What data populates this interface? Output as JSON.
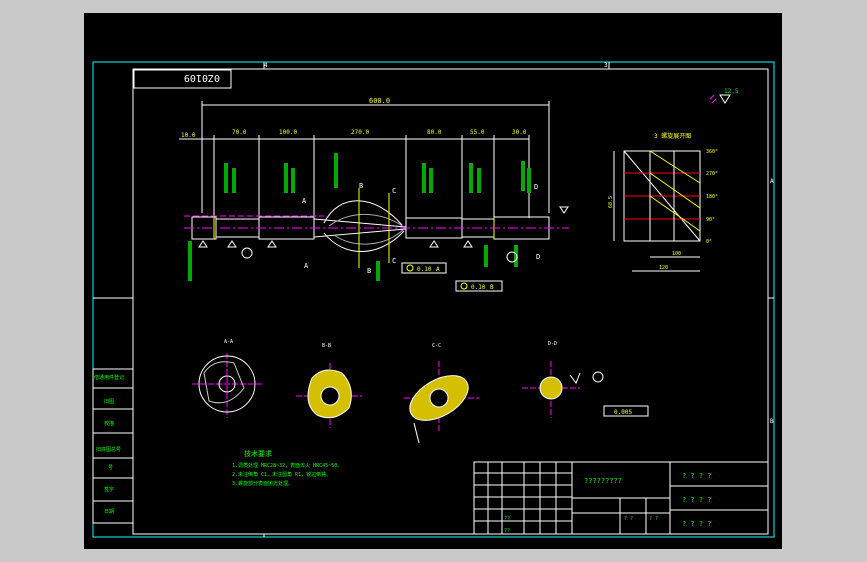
{
  "drawing": {
    "code_box": "0Z0109",
    "zone_top_a": "4",
    "zone_top_b": "3",
    "zone_right_a": "A",
    "zone_right_b": "B",
    "overall_dim": "600.0",
    "dims_top": [
      "10.0",
      "70.0",
      "100.0",
      "270.0",
      "80.0",
      "55.0",
      "30.0"
    ],
    "surface_symbol": "12.5",
    "section_labels": {
      "a": "A-A",
      "b": "B-B",
      "c": "C-C",
      "d": "D-D"
    },
    "cut_letters": {
      "a": "A",
      "b": "B",
      "c": "C",
      "d": "D"
    },
    "tolerance_1": "0.10",
    "tolerance_2": "0.10",
    "tolerance_3": "0.005",
    "datum_a": "A",
    "datum_b": "B",
    "unwrap_title": "3 螺旋展开图",
    "unwrap_angles": [
      "360°",
      "270°",
      "180°",
      "90°",
      "0°"
    ],
    "unwrap_width": "120",
    "unwrap_inner": "100",
    "unwrap_height": "68.5",
    "tech_heading": "技术要求",
    "tech_lines": [
      "1.调质处理 HRC28~32，表面淬火 HRC45~50。",
      "2.未注倒角 C1，未注圆角 R1，锐边倒钝。",
      "3.螺旋部分表面抛光处理。"
    ],
    "title_cell": "?????????",
    "title_right": [
      "? ? ? ?",
      "? ? ? ?",
      "? ? ? ?"
    ],
    "table_marks": [
      "??",
      "??",
      "? ?",
      "? ?"
    ],
    "left_strip": [
      "借通用件登记",
      "旧图",
      "校描",
      "旧底图总号",
      "号",
      "签字",
      "日期"
    ]
  }
}
